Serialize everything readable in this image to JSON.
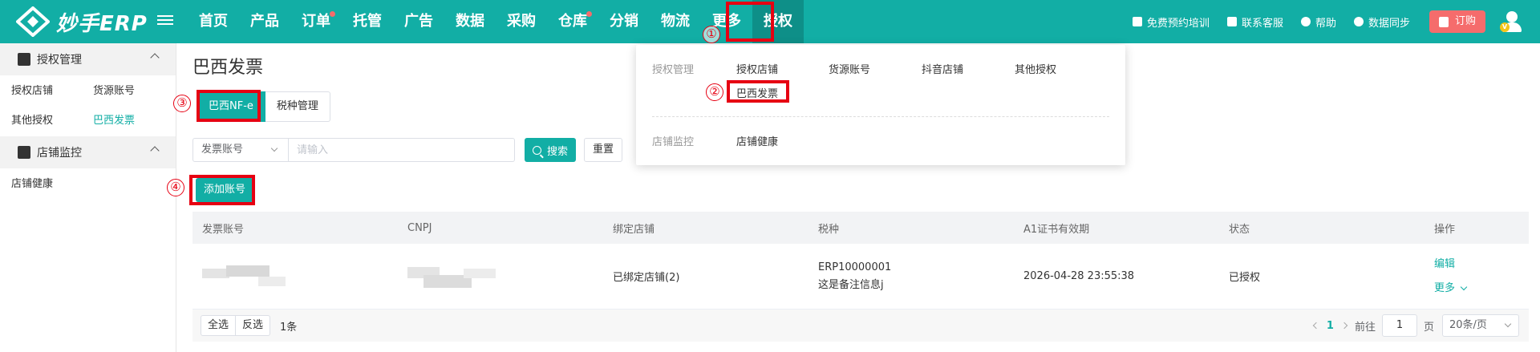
{
  "brand": {
    "name": "妙手ERP"
  },
  "nav": {
    "items": [
      {
        "label": "首页",
        "dot": false
      },
      {
        "label": "产品",
        "dot": false
      },
      {
        "label": "订单",
        "dot": true
      },
      {
        "label": "托管",
        "dot": false
      },
      {
        "label": "广告",
        "dot": false
      },
      {
        "label": "数据",
        "dot": false
      },
      {
        "label": "采购",
        "dot": false
      },
      {
        "label": "仓库",
        "dot": true
      },
      {
        "label": "分销",
        "dot": false
      },
      {
        "label": "物流",
        "dot": false
      },
      {
        "label": "更多",
        "dot": false
      },
      {
        "label": "授权",
        "dot": false,
        "active": true
      }
    ]
  },
  "tools": {
    "training": "免费预约培训",
    "support": "联系客服",
    "help": "帮助",
    "sync": "数据同步",
    "order": "订购"
  },
  "sidebar": {
    "group1": {
      "title": "授权管理",
      "links": [
        "授权店铺",
        "货源账号",
        "其他授权",
        "巴西发票"
      ],
      "active_index": 3
    },
    "group2": {
      "title": "店铺监控",
      "links": [
        "店铺健康"
      ]
    }
  },
  "page": {
    "title": "巴西发票",
    "tabs": [
      "巴西NF-e",
      "税种管理"
    ],
    "filter": {
      "select_value": "发票账号",
      "placeholder": "请输入",
      "search_label": "搜索",
      "reset_label": "重置"
    },
    "add_label": "添加账号"
  },
  "table": {
    "headers": [
      "发票账号",
      "CNPJ",
      "绑定店铺",
      "税种",
      "A1证书有效期",
      "状态",
      "操作"
    ],
    "rows": [
      {
        "bound_store": "已绑定店铺(2)",
        "tax_code": "ERP10000001",
        "tax_note": "这是备注信息j",
        "cert_expiry": "2026-04-28 23:55:38",
        "status": "已授权",
        "op_edit": "编辑",
        "op_more": "更多"
      }
    ],
    "footer": {
      "select_all": "全选",
      "invert": "反选",
      "count": "1条",
      "current_page": "1",
      "goto_label": "前往",
      "goto_value": "1",
      "page_unit": "页",
      "page_size": "20条/页"
    }
  },
  "dropdown": {
    "section1_label": "授权管理",
    "section1_items": [
      "授权店铺",
      "货源账号",
      "抖音店铺",
      "其他授权",
      "巴西发票"
    ],
    "section2_label": "店铺监控",
    "section2_items": [
      "店铺健康"
    ]
  },
  "annotations": [
    "①",
    "②",
    "③",
    "④"
  ],
  "colors": {
    "primary": "#12aea5",
    "highlight": "#e60012",
    "order_button": "#f56c6c"
  }
}
